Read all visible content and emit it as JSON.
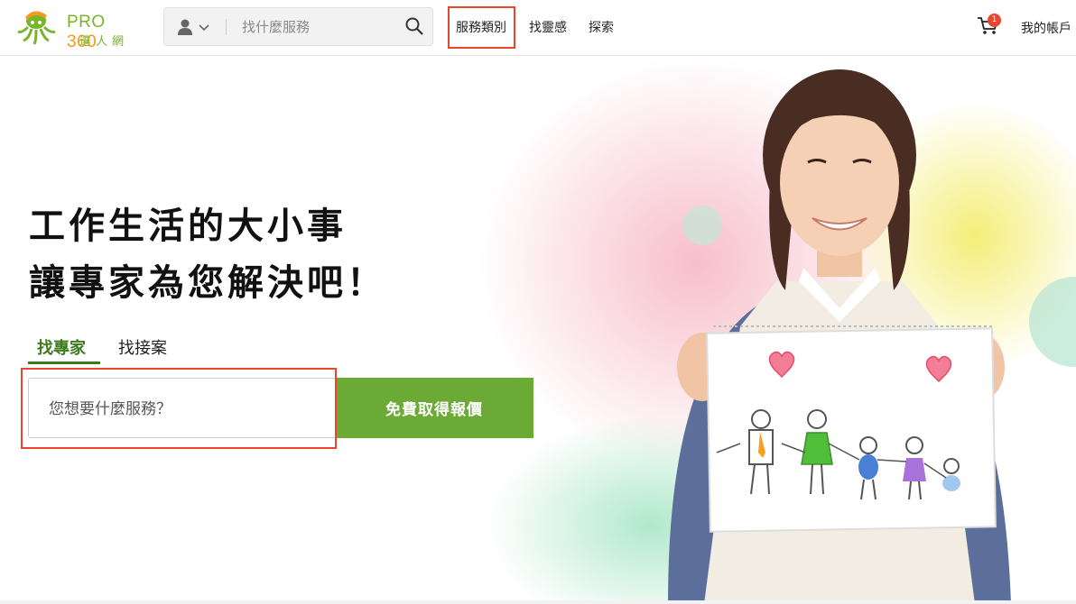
{
  "logo": {
    "brand": "PRO",
    "number": "360",
    "subtitle": "達人網",
    "icon": "octopus-logo-icon"
  },
  "search": {
    "placeholder": "找什麼服務",
    "user_icon": "user-icon",
    "chevron_icon": "chevron-down-icon",
    "search_icon": "search-icon"
  },
  "nav": {
    "items": [
      "服務類別",
      "找靈感",
      "探索"
    ],
    "highlighted_index": 0
  },
  "cart": {
    "icon": "cart-icon",
    "count": "1"
  },
  "account": {
    "label": "我的帳戶"
  },
  "hero": {
    "headline_line1": "工作生活的大小事",
    "headline_line2": "讓專家為您解決吧！",
    "tabs": [
      {
        "label": "找專家",
        "active": true
      },
      {
        "label": "找接案",
        "active": false
      }
    ],
    "input_placeholder": "您想要什麼服務？",
    "cta_label": "免費取得報價"
  },
  "colors": {
    "brand_green": "#79b52a",
    "brand_orange": "#f39a1e",
    "cta_green": "#6aaa35",
    "tab_active": "#3e7b1e",
    "highlight": "#e8462e"
  }
}
